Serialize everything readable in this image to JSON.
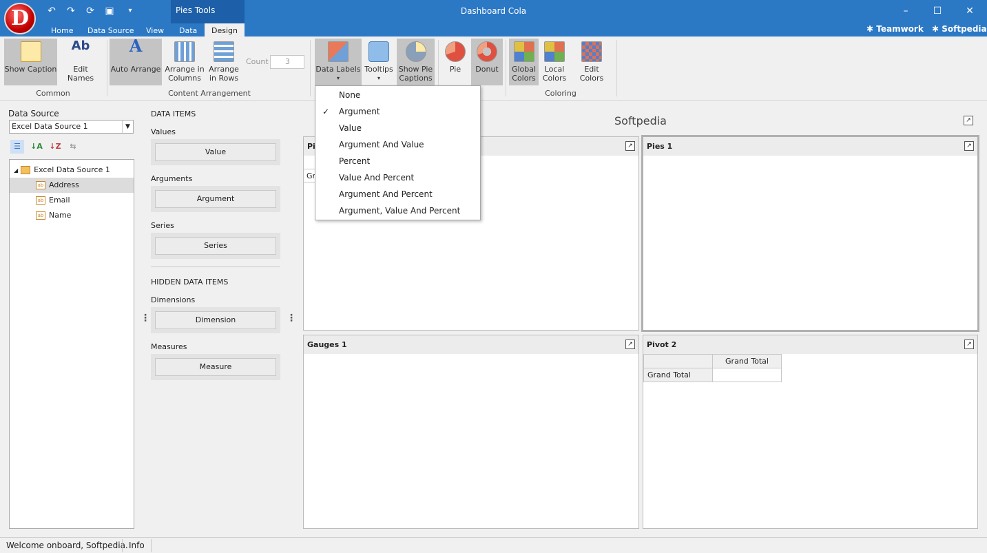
{
  "window": {
    "title": "Dashboard Cola",
    "context_tab": "Pies Tools"
  },
  "tabs": [
    "Home",
    "Data Source",
    "View",
    "Data",
    "Design"
  ],
  "users": {
    "teamwork": "Teamwork",
    "softpedia": "Softpedia"
  },
  "ribbon": {
    "show_caption": "Show Caption",
    "edit_names": "Edit Names",
    "common": "Common",
    "auto_arrange": "Auto Arrange",
    "arrange_cols_1": "Arrange in",
    "arrange_cols_2": "Columns",
    "arrange_rows_1": "Arrange",
    "arrange_rows_2": "in Rows",
    "count_label": "Count",
    "count_value": "3",
    "content_arrangement": "Content Arrangement",
    "data_labels": "Data Labels",
    "tooltips": "Tooltips",
    "show_pie_1": "Show Pie",
    "show_pie_2": "Captions",
    "pie": "Pie",
    "donut": "Donut",
    "global_colors_1": "Global",
    "global_colors_2": "Colors",
    "local_colors_1": "Local",
    "local_colors_2": "Colors",
    "edit_colors": "Edit Colors",
    "coloring": "Coloring"
  },
  "data_source": {
    "label": "Data Source",
    "selected": "Excel Data Source 1",
    "tree": {
      "root": "Excel Data Source 1",
      "fields": [
        "Address",
        "Email",
        "Name"
      ]
    }
  },
  "data_items": {
    "header": "DATA ITEMS",
    "values": "Values",
    "values_btn": "Value",
    "arguments": "Arguments",
    "arguments_btn": "Argument",
    "series": "Series",
    "series_btn": "Series",
    "hidden_header": "HIDDEN DATA ITEMS",
    "dimensions": "Dimensions",
    "dimensions_btn": "Dimension",
    "measures": "Measures",
    "measures_btn": "Measure"
  },
  "dashboard": {
    "title": "Softpedia",
    "panels": {
      "pies": "Pies 1",
      "gauges": "Gauges 1",
      "pivot": "Pivot 2"
    },
    "pivot": {
      "col_header": "Grand Total",
      "row_header": "Grand Total"
    }
  },
  "menu": {
    "items": [
      "None",
      "Argument",
      "Value",
      "Argument And Value",
      "Percent",
      "Value And Percent",
      "Argument And Percent",
      "Argument, Value And Percent"
    ],
    "checked": "Argument"
  },
  "status": {
    "message": "Welcome onboard, Softpedia.",
    "info": "Info"
  }
}
